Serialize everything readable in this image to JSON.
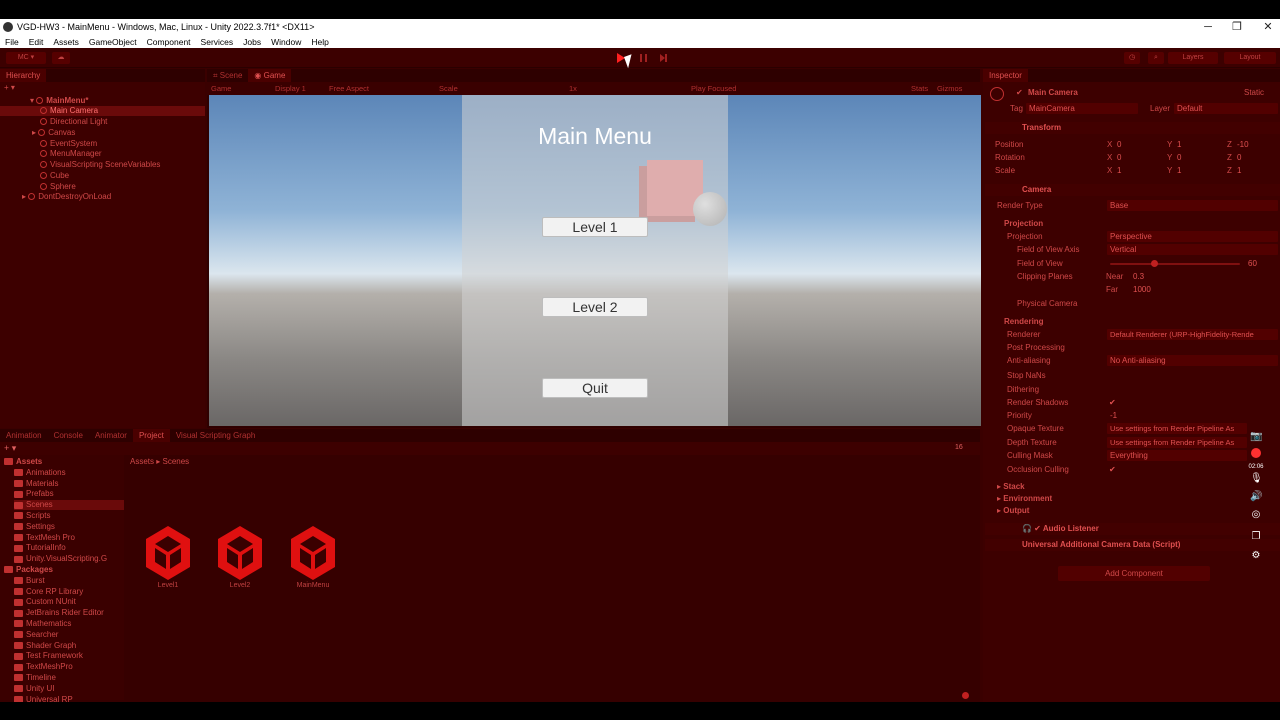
{
  "window": {
    "title": "VGD-HW3 - MainMenu - Windows, Mac, Linux - Unity 2022.3.7f1* <DX11>",
    "minimize": "─",
    "maximize": "❐",
    "close": "✕"
  },
  "menubar": [
    "File",
    "Edit",
    "Assets",
    "GameObject",
    "Component",
    "Services",
    "Jobs",
    "Window",
    "Help"
  ],
  "toolbar": {
    "account": "MC ▾",
    "layers": "Layers",
    "layout": "Layout"
  },
  "hierarchy": {
    "tab": "Hierarchy",
    "scene": "MainMenu*",
    "items": [
      "Main Camera",
      "Directional Light",
      "Canvas",
      "EventSystem",
      "MenuManager",
      "VisualScripting SceneVariables",
      "Cube",
      "Sphere"
    ],
    "dontdestroy": "DontDestroyOnLoad"
  },
  "center_tabs": {
    "scene": "Scene",
    "game": "Game"
  },
  "game_toolbar": {
    "mode": "Game",
    "display": "Display 1",
    "aspect": "Free Aspect",
    "scale_label": "Scale",
    "scale_value": "1x",
    "play_focused": "Play Focused",
    "stats": "Stats",
    "gizmos": "Gizmos"
  },
  "game_ui": {
    "title": "Main Menu",
    "buttons": [
      "Level 1",
      "Level 2",
      "Quit"
    ]
  },
  "bottom_tabs": [
    "Animation",
    "Console",
    "Animator",
    "Project",
    "Visual Scripting Graph"
  ],
  "project": {
    "tree": [
      {
        "label": "Assets",
        "level": 0,
        "bold": true
      },
      {
        "label": "Animations",
        "level": 1
      },
      {
        "label": "Materials",
        "level": 1
      },
      {
        "label": "Prefabs",
        "level": 1
      },
      {
        "label": "Scenes",
        "level": 1,
        "selected": true
      },
      {
        "label": "Scripts",
        "level": 1
      },
      {
        "label": "Settings",
        "level": 1
      },
      {
        "label": "TextMesh Pro",
        "level": 1
      },
      {
        "label": "TutorialInfo",
        "level": 1
      },
      {
        "label": "Unity.VisualScripting.G",
        "level": 1
      },
      {
        "label": "Packages",
        "level": 0,
        "bold": true
      },
      {
        "label": "Burst",
        "level": 1
      },
      {
        "label": "Core RP Library",
        "level": 1
      },
      {
        "label": "Custom NUnit",
        "level": 1
      },
      {
        "label": "JetBrains Rider Editor",
        "level": 1
      },
      {
        "label": "Mathematics",
        "level": 1
      },
      {
        "label": "Searcher",
        "level": 1
      },
      {
        "label": "Shader Graph",
        "level": 1
      },
      {
        "label": "Test Framework",
        "level": 1
      },
      {
        "label": "TextMeshPro",
        "level": 1
      },
      {
        "label": "Timeline",
        "level": 1
      },
      {
        "label": "Unity UI",
        "level": 1
      },
      {
        "label": "Universal RP",
        "level": 1
      }
    ],
    "breadcrumb": [
      "Assets",
      "Scenes"
    ],
    "assets": [
      "Level1",
      "Level2",
      "MainMenu"
    ],
    "count": "16"
  },
  "inspector": {
    "tab": "Inspector",
    "object_name": "Main Camera",
    "static": "Static",
    "tag_label": "Tag",
    "tag_value": "MainCamera",
    "layer_label": "Layer",
    "layer_value": "Default",
    "transform": {
      "title": "Transform",
      "rows": [
        {
          "label": "Position",
          "x": "0",
          "y": "1",
          "z": "-10"
        },
        {
          "label": "Rotation",
          "x": "0",
          "y": "0",
          "z": "0"
        },
        {
          "label": "Scale",
          "x": "1",
          "y": "1",
          "z": "1"
        }
      ]
    },
    "camera": {
      "title": "Camera",
      "render_type_label": "Render Type",
      "render_type": "Base",
      "projection_head": "Projection",
      "projection_label": "Projection",
      "projection": "Perspective",
      "fov_axis_label": "Field of View Axis",
      "fov_axis": "Vertical",
      "fov_label": "Field of View",
      "fov": "60",
      "clipping_label": "Clipping Planes",
      "near_label": "Near",
      "near": "0.3",
      "far_label": "Far",
      "far": "1000",
      "physical_label": "Physical Camera",
      "rendering_head": "Rendering",
      "renderer_label": "Renderer",
      "renderer": "Default Renderer (URP-HighFidelity-Rende",
      "postproc_label": "Post Processing",
      "aa_label": "Anti-aliasing",
      "aa": "No Anti-aliasing",
      "stopnans_label": "Stop NaNs",
      "dithering_label": "Dithering",
      "shadows_label": "Render Shadows",
      "priority_label": "Priority",
      "priority": "-1",
      "opaque_label": "Opaque Texture",
      "opaque": "Use settings from Render Pipeline As",
      "depth_label": "Depth Texture",
      "depth": "Use settings from Render Pipeline As",
      "culling_label": "Culling Mask",
      "culling": "Everything",
      "occlusion_label": "Occlusion Culling",
      "stack": "Stack",
      "environment": "Environment",
      "output": "Output"
    },
    "audio_listener": "Audio Listener",
    "urp_data": "Universal Additional Camera Data (Script)",
    "add_component": "Add Component"
  },
  "recorder": {
    "time": "02:06"
  }
}
